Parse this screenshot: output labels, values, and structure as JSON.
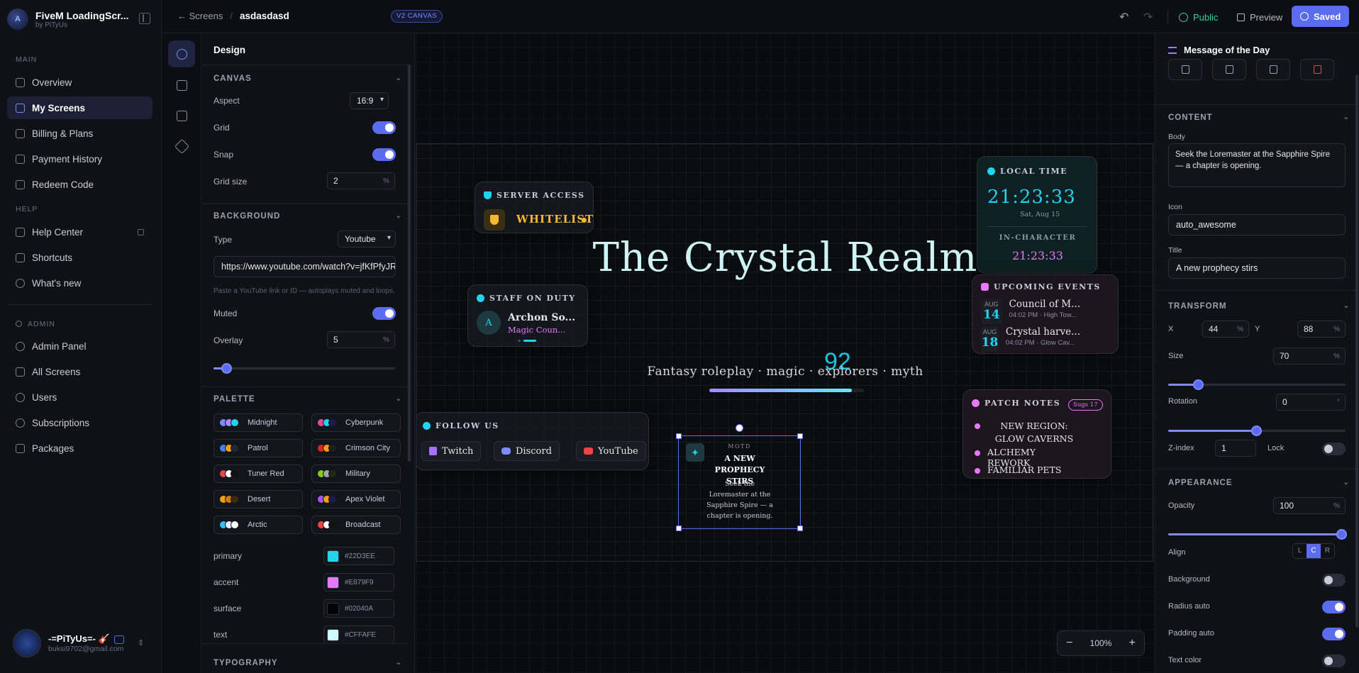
{
  "app": {
    "title": "FiveM LoadingScr...",
    "subtitle": "by PiTyUs"
  },
  "nav": {
    "main_label": "MAIN",
    "main": [
      "Overview",
      "My Screens",
      "Billing & Plans",
      "Payment History",
      "Redeem Code"
    ],
    "help_label": "HELP",
    "help": [
      "Help Center",
      "Shortcuts",
      "What's new"
    ],
    "admin_label": "ADMIN",
    "admin": [
      "Admin Panel",
      "All Screens",
      "Users",
      "Subscriptions",
      "Packages"
    ],
    "active": "My Screens"
  },
  "user": {
    "name": "-=PiTyUs=- 🎸",
    "email": "buksi9702@gmail.com"
  },
  "topbar": {
    "back_label": "Screens",
    "screen_name": "asdasdasd",
    "badge": "V2 CANVAS",
    "public_label": "Public",
    "preview_label": "Preview",
    "saved_label": "Saved"
  },
  "design": {
    "title": "Design",
    "canvas": {
      "heading": "CANVAS",
      "aspect_label": "Aspect",
      "aspect_value": "16:9",
      "grid_label": "Grid",
      "grid_on": true,
      "snap_label": "Snap",
      "snap_on": true,
      "gridsize_label": "Grid size",
      "gridsize_value": "2",
      "gridsize_unit": "%"
    },
    "background": {
      "heading": "BACKGROUND",
      "type_label": "Type",
      "type_value": "Youtube",
      "url_value": "https://www.youtube.com/watch?v=jfKfPfyJRdk",
      "hint": "Paste a YouTube link or ID — autoplays muted and loops.",
      "muted_label": "Muted",
      "muted_on": true,
      "overlay_label": "Overlay",
      "overlay_value": "5",
      "overlay_unit": "%",
      "overlay_level": 0.05
    },
    "palette": {
      "heading": "PALETTE",
      "items": [
        {
          "name": "Midnight",
          "colors": [
            "#7c8cff",
            "#a78bfa",
            "#22d3ee"
          ]
        },
        {
          "name": "Cyberpunk",
          "colors": [
            "#ec4899",
            "#22d3ee",
            "#1e1b4b"
          ]
        },
        {
          "name": "Patrol",
          "colors": [
            "#3b82f6",
            "#f59e0b",
            "#1f2937"
          ]
        },
        {
          "name": "Crimson City",
          "colors": [
            "#dc2626",
            "#f59e0b",
            "#1f1f1f"
          ]
        },
        {
          "name": "Tuner Red",
          "colors": [
            "#ef4444",
            "#ffffff",
            "#111111"
          ]
        },
        {
          "name": "Military",
          "colors": [
            "#84cc16",
            "#a3a3a3",
            "#1f2a14"
          ]
        },
        {
          "name": "Desert",
          "colors": [
            "#f59e0b",
            "#d97706",
            "#3f2a14"
          ]
        },
        {
          "name": "Apex Violet",
          "colors": [
            "#a855f7",
            "#f59e0b",
            "#1e1b4b"
          ]
        },
        {
          "name": "Arctic",
          "colors": [
            "#38bdf8",
            "#e0f2fe",
            "#ffffff"
          ]
        },
        {
          "name": "Broadcast",
          "colors": [
            "#ef4444",
            "#ffffff",
            "#111111"
          ]
        }
      ],
      "colors": [
        {
          "label": "primary",
          "value": "#22D3EE"
        },
        {
          "label": "accent",
          "value": "#E879F9"
        },
        {
          "label": "surface",
          "value": "#02040A"
        },
        {
          "label": "text",
          "value": "#CFFAFE"
        }
      ]
    },
    "typography_heading": "TYPOGRAPHY"
  },
  "canvas": {
    "title": "The Crystal Realm",
    "tagline": "Fantasy roleplay · magic · explorers · myth",
    "counter": "92",
    "loading_progress": 0.92,
    "server_access": {
      "heading": "SERVER ACCESS",
      "value": "WHITELIST"
    },
    "local_time": {
      "heading": "LOCAL TIME",
      "time": "21:23:33",
      "date": "Sat, Aug 15",
      "ic_label": "IN-CHARACTER",
      "ic_time": "21:23:33"
    },
    "staff": {
      "heading": "STAFF ON DUTY",
      "initial": "A",
      "name": "Archon So...",
      "role": "Magic Coun..."
    },
    "events": {
      "heading": "UPCOMING EVENTS",
      "items": [
        {
          "month": "AUG",
          "day": "14",
          "title": "Council of M...",
          "meta": "04:02 PM · High Tow..."
        },
        {
          "month": "AUG",
          "day": "18",
          "title": "Crystal harve...",
          "meta": "04:02 PM · Glow Cav..."
        }
      ]
    },
    "follow": {
      "heading": "FOLLOW US",
      "links": [
        "Twitch",
        "Discord",
        "YouTube"
      ]
    },
    "motd": {
      "kicker": "MOTD",
      "title": "A new prophecy stirs",
      "body": "Seek the Loremaster at the Sapphire Spire — a chapter is opening."
    },
    "patch": {
      "heading": "PATCH NOTES",
      "badge": "Sugs 17",
      "items": [
        "New region: Glow Caverns",
        "Alchemy rework",
        "Familiar pets"
      ]
    },
    "zoom": "100%"
  },
  "inspector": {
    "title": "Message of the Day",
    "content_heading": "CONTENT",
    "body_label": "Body",
    "body_value": "Seek the Loremaster at the Sapphire Spire — a chapter is opening.",
    "icon_label": "Icon",
    "icon_value": "auto_awesome",
    "title_label": "Title",
    "title_value": "A new prophecy stirs",
    "transform_heading": "TRANSFORM",
    "x_label": "X",
    "x_value": "44",
    "y_label": "Y",
    "y_value": "88",
    "size_label": "Size",
    "size_value": "70",
    "rotation_label": "Rotation",
    "rotation_value": "0",
    "zindex_label": "Z-index",
    "zindex_value": "1",
    "lock_label": "Lock",
    "appearance_heading": "APPEARANCE",
    "opacity_label": "Opacity",
    "opacity_value": "100",
    "align_label": "Align",
    "align_options": [
      "L",
      "C",
      "R"
    ],
    "background_label": "Background",
    "radius_label": "Radius auto",
    "padding_label": "Padding auto",
    "textcolor_label": "Text color",
    "unit_pct": "%",
    "unit_deg": "°"
  }
}
